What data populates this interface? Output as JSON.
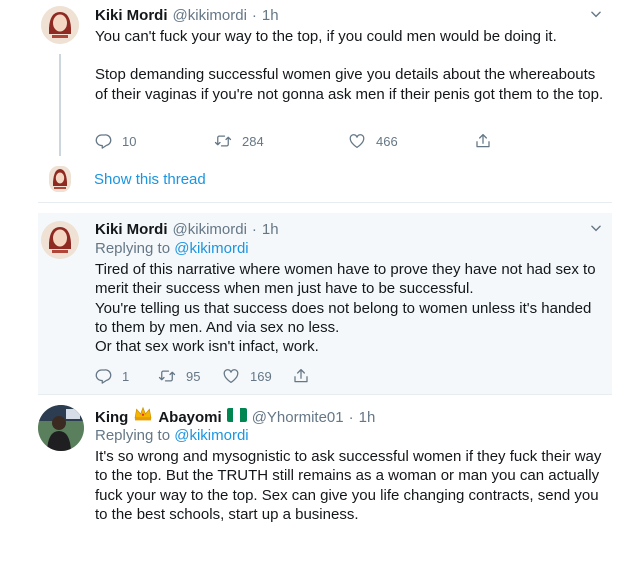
{
  "tweets": [
    {
      "name": "Kiki Mordi",
      "handle": "@kikimordi",
      "dot": "·",
      "time": "1h",
      "paragraphs": [
        "You can't fuck your way to the top, if you could men would be doing it.",
        "Stop demanding successful women give you details about the whereabouts of their vaginas if you're not gonna ask men if their penis got them to the top."
      ],
      "replies": "10",
      "retweets": "284",
      "likes": "466",
      "show_thread": "Show this thread"
    },
    {
      "name": "Kiki Mordi",
      "handle": "@kikimordi",
      "dot": "·",
      "time": "1h",
      "replying_prefix": "Replying to",
      "replying_handle": "@kikimordi",
      "paragraphs": [
        "Tired of this narrative where women have to prove they have not had sex to merit their success when men just have to be successful.",
        "You're telling us that success does not belong to women unless it's handed to them by men. And via sex no less.",
        "Or that sex work isn't infact, work."
      ],
      "replies": "1",
      "retweets": "95",
      "likes": "169"
    },
    {
      "name_first": "King",
      "name_second": "Abayomi",
      "handle": "@Yhormite01",
      "dot": "·",
      "time": "1h",
      "replying_prefix": "Replying to",
      "replying_handle": "@kikimordi",
      "paragraphs": [
        "It's so wrong and mysognistic to ask successful women if they fuck their way to the top. But the TRUTH  still remains as a woman or man you can actually fuck your way to the top. Sex can give you life changing contracts, send you to the best schools, start up a business."
      ]
    }
  ],
  "icons": {
    "reply": "reply-icon",
    "retweet": "retweet-icon",
    "like": "heart-icon",
    "share": "share-icon",
    "more": "chevron-down-icon",
    "crown": "crown-emoji",
    "flag": "nigeria-flag-emoji"
  },
  "colors": {
    "link": "#1b95e0",
    "muted": "#657786",
    "text": "#14171a",
    "highlight_bg": "#f5f8fa",
    "border": "#e6ecf0",
    "flag_green": "#008751"
  }
}
